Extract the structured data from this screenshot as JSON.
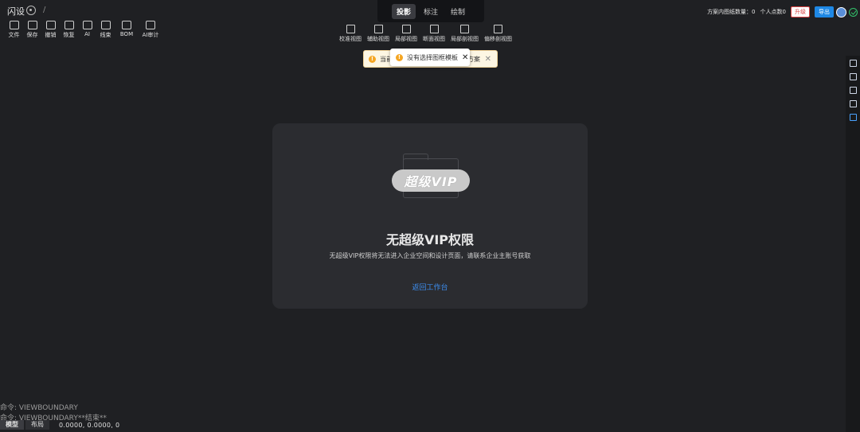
{
  "app": {
    "name": "闪设",
    "separator": "/"
  },
  "toolbar": {
    "items": [
      {
        "label": "文件",
        "icon": "folder-icon"
      },
      {
        "label": "保存",
        "icon": "save-icon"
      },
      {
        "label": "撤销",
        "icon": "undo-icon"
      },
      {
        "label": "恢复",
        "icon": "redo-icon"
      },
      {
        "label": "AI",
        "icon": "ai-icon"
      },
      {
        "label": "线束",
        "icon": "wire-icon"
      },
      {
        "label": "BOM",
        "icon": "bom-icon"
      },
      {
        "label": "AI审计",
        "icon": "audit-icon"
      }
    ]
  },
  "modes": {
    "tabs": [
      "投影",
      "标注",
      "绘制"
    ],
    "active": "投影"
  },
  "views": [
    {
      "label": "校准视图"
    },
    {
      "label": "辅助视图"
    },
    {
      "label": "局部视图"
    },
    {
      "label": "断面视图"
    },
    {
      "label": "局部剖视图"
    },
    {
      "label": "偏移剖视图"
    }
  ],
  "header_right": {
    "drawing_count_label": "方案内图纸数量：0",
    "points_label": "个人点数0",
    "upgrade_label": "升级",
    "export_label": "导出"
  },
  "toasts": {
    "back": {
      "left_text": "当前",
      "right_text": "方案"
    },
    "front": {
      "text": "没有选择图框模板"
    }
  },
  "card": {
    "badge_text": "超级VIP",
    "title": "无超级VIP权限",
    "description": "无超级VIP权限将无法进入企业空间和设计页面，请联系企业主账号获取",
    "link": "返回工作台"
  },
  "console": {
    "lines": [
      "命令: VIEWBOUNDARY",
      "命令: VIEWBOUNDARY**结束**"
    ]
  },
  "status": {
    "tabs": [
      "模型",
      "布局"
    ],
    "active": "模型",
    "coords": "0.0000,   0.0000,   0"
  },
  "colors": {
    "accent": "#1e88e5",
    "link": "#3d8ef0",
    "warning": "#f5a623",
    "danger": "#d94141"
  }
}
